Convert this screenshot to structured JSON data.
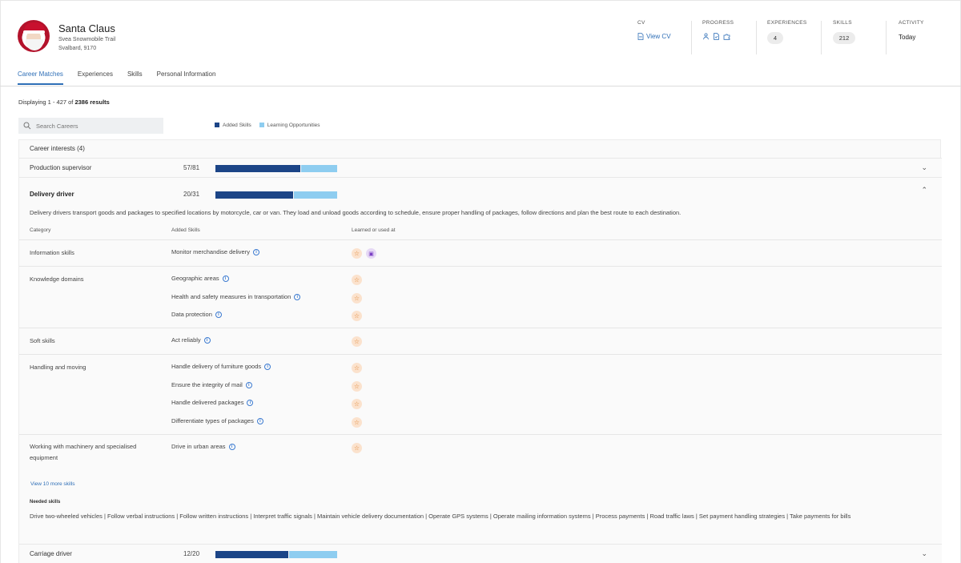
{
  "profile": {
    "name": "Santa Claus",
    "address_line1": "Svea Snowmobile Trail",
    "address_line2": "Svalbard, 9170"
  },
  "stats": {
    "cv": {
      "label": "CV",
      "link": "View CV"
    },
    "progress": {
      "label": "PROGRESS"
    },
    "experiences": {
      "label": "EXPERIENCES",
      "value": "4"
    },
    "skills": {
      "label": "SKILLS",
      "value": "212"
    },
    "activity": {
      "label": "ACTIVITY",
      "value": "Today"
    }
  },
  "tabs": [
    {
      "label": "Career Matches",
      "active": true
    },
    {
      "label": "Experiences",
      "active": false
    },
    {
      "label": "Skills",
      "active": false
    },
    {
      "label": "Personal Information",
      "active": false
    }
  ],
  "results": {
    "prefix": "Displaying 1 - 427 of ",
    "total": "2386 results"
  },
  "search": {
    "placeholder": "Search Careers"
  },
  "legend": {
    "added": "Added Skills",
    "learning": "Learning Opportunities"
  },
  "colors": {
    "added": "#1c4587",
    "learning": "#8ecdf0",
    "accent": "#2f6fb7"
  },
  "career_interests": {
    "title": "Career interests (4)",
    "careers": [
      {
        "name": "Production supervisor",
        "score": "57/81",
        "added_fraction": 0.7,
        "learning_fraction": 0.3,
        "expanded": false
      },
      {
        "name": "Delivery driver",
        "score": "20/31",
        "added_fraction": 0.645,
        "learning_fraction": 0.355,
        "expanded": true
      },
      {
        "name": "Carriage driver",
        "score": "12/20",
        "added_fraction": 0.6,
        "learning_fraction": 0.4,
        "expanded": false
      }
    ]
  },
  "detail": {
    "description": "Delivery drivers transport goods and packages to specified locations by motorcycle, car or van. They load and unload goods according to schedule, ensure proper handling of packages, follow directions and plan the best route to each destination.",
    "columns": {
      "category": "Category",
      "added": "Added Skills",
      "learned": "Learned or used at"
    },
    "categories": [
      {
        "name": "Information skills",
        "skills": [
          "Monitor merchandise delivery"
        ]
      },
      {
        "name": "Knowledge domains",
        "skills": [
          "Geographic areas",
          "Health and safety measures in transportation",
          "Data protection"
        ]
      },
      {
        "name": "Soft skills",
        "skills": [
          "Act reliably"
        ]
      },
      {
        "name": "Handling and moving",
        "skills": [
          "Handle delivery of furniture goods",
          "Ensure the integrity of mail",
          "Handle delivered packages",
          "Differentiate types of packages"
        ]
      },
      {
        "name": "Working with machinery and specialised equipment",
        "skills": [
          "Drive in urban areas"
        ]
      }
    ],
    "more_link": "View 10 more skills",
    "needed_title": "Needed skills",
    "needed_text": "Drive two-wheeled vehicles | Follow verbal instructions | Follow written instructions | Interpret traffic signals | Maintain vehicle delivery documentation | Operate GPS systems | Operate mailing information systems | Process payments | Road traffic laws | Set payment handling strategies | Take payments for bills"
  }
}
